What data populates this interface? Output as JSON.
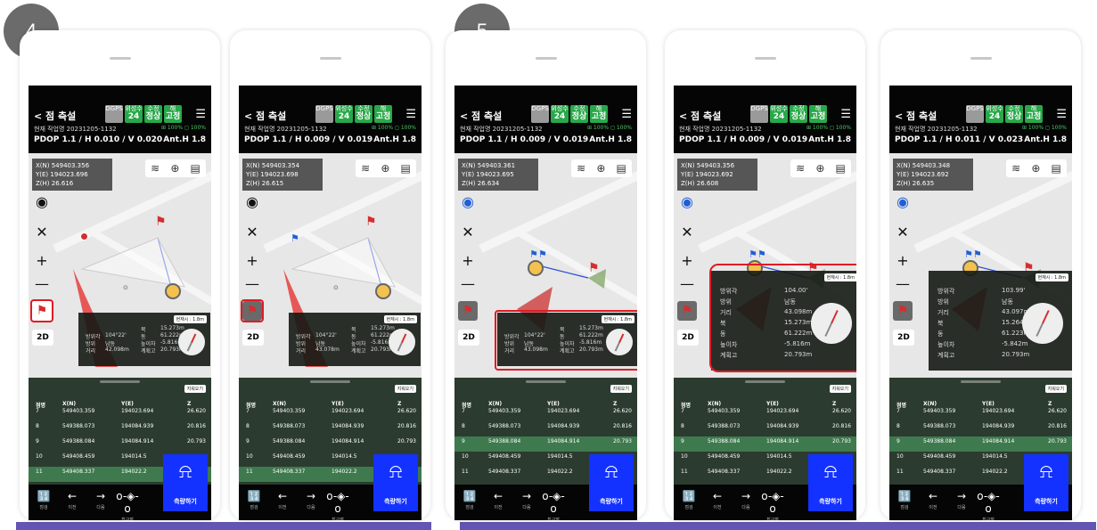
{
  "steps": [
    {
      "number": "4"
    },
    {
      "number": "5"
    }
  ],
  "colors": {
    "header_bg": "#050505",
    "chip_green": "#28a84a",
    "flag_red": "#d62d2d",
    "measure_blue": "#1432ff",
    "highlight_red": "#e01b24",
    "purple_bar": "#6355b3",
    "row_highlight": "#3e7a4e"
  },
  "app": {
    "back_title": "< 점 측설",
    "menu_icon": "hamburger-icon",
    "status_chips": [
      {
        "top": "DGPS",
        "value": ""
      },
      {
        "top": "위성수",
        "value": "24"
      },
      {
        "top": "수정",
        "value": "정상"
      },
      {
        "top": "해",
        "value": "고정"
      }
    ],
    "job_label": "현재 작업명 20231205-1132",
    "battery": "⊞ 100%  ◻ 100%",
    "ant_h": "Ant.H 1.8",
    "map_tools": [
      "layers-icon",
      "gps-settings-icon",
      "list-icon"
    ],
    "controls": {
      "locate": "◉",
      "fit": "✕",
      "zoom_in": "+",
      "zoom_out": "—",
      "flag": "⚑",
      "mode_2d": "2D"
    },
    "popup": {
      "badge": "현재시 : 1.8m",
      "compact_rows": [
        {
          "label": "방위각",
          "value": "104°22'"
        },
        {
          "label": "방위",
          "value": "남동"
        },
        {
          "label": "거리",
          "value": "43.098m"
        }
      ],
      "right_rows": [
        {
          "label": "북",
          "value": "15.273m"
        },
        {
          "label": "동",
          "value": "61.222m"
        },
        {
          "label": "높이차",
          "value": "-5.816m"
        },
        {
          "label": "계획고",
          "value": "20.793m"
        }
      ]
    },
    "table": {
      "button": "지워오기",
      "headers": [
        "점명",
        "X(N)",
        "Y(E)",
        "Z"
      ],
      "rows": [
        {
          "id": "7",
          "x": "549403.359",
          "y": "194023.694",
          "z": "26.620"
        },
        {
          "id": "8",
          "x": "549388.073",
          "y": "194084.939",
          "z": "20.816"
        },
        {
          "id": "9",
          "x": "549388.084",
          "y": "194084.914",
          "z": "20.793"
        },
        {
          "id": "10",
          "x": "549408.459",
          "y": "194014.5",
          "z": ""
        },
        {
          "id": "11",
          "x": "549408.337",
          "y": "194022.2",
          "z": ""
        }
      ]
    },
    "measure_label": "측량하기",
    "measure_icon": "survey-pole-icon",
    "nav": [
      {
        "icon": "🔢",
        "label": "점검"
      },
      {
        "icon": "←",
        "label": "이전"
      },
      {
        "icon": "→",
        "label": "다음"
      },
      {
        "icon": "o-◈-o",
        "label": "최근점"
      }
    ]
  },
  "phones": [
    {
      "pdop": "PDOP 1.1 / H 0.010 / V 0.020",
      "coords": {
        "x": "X(N) 549403.356",
        "y": "Y(E) 194023.696",
        "z": "Z(H) 26.616"
      },
      "selected_row": "11",
      "popup_distance": "42.098m"
    },
    {
      "pdop": "PDOP 1.1 / H 0.009 / V 0.019",
      "coords": {
        "x": "X(N) 549403.354",
        "y": "Y(E) 194023.698",
        "z": "Z(H) 26.615"
      },
      "selected_row": "11",
      "popup_distance": "43.078m"
    },
    {
      "pdop": "PDOP 1.1 / H 0.009 / V 0.019",
      "coords": {
        "x": "X(N) 549403.361",
        "y": "Y(E) 194023.695",
        "z": "Z(H) 26.634"
      },
      "selected_row": "9",
      "popup_distance": "43.098m"
    },
    {
      "pdop": "PDOP 1.1 / H 0.009 / V 0.019",
      "coords": {
        "x": "X(N) 549403.356",
        "y": "Y(E) 194023.692",
        "z": "Z(H) 26.608"
      },
      "selected_row": "9",
      "popup_distance": "43.098m",
      "popup_big": {
        "bearing": "104.00'",
        "direction": "남동",
        "distance": "43.098m",
        "north": "15.273m",
        "east": "61.222m",
        "height_diff": "-5.816m",
        "plan_height": "20.793m"
      }
    },
    {
      "pdop": "PDOP 1.1 / H 0.011 / V 0.023",
      "coords": {
        "x": "X(N) 549403.348",
        "y": "Y(E) 194023.692",
        "z": "Z(H) 26.635"
      },
      "selected_row": "9",
      "popup_distance": "43.097m",
      "popup_big": {
        "bearing": "103.99'",
        "direction": "남동",
        "distance": "43.097m",
        "north": "15.264m",
        "east": "61.223m",
        "height_diff": "-5.842m",
        "plan_height": "20.793m"
      }
    }
  ],
  "big_labels": {
    "bearing": "방위각",
    "direction": "방위",
    "distance": "거리",
    "north": "북",
    "east": "동",
    "height_diff": "높이차",
    "plan_height": "계획고"
  }
}
